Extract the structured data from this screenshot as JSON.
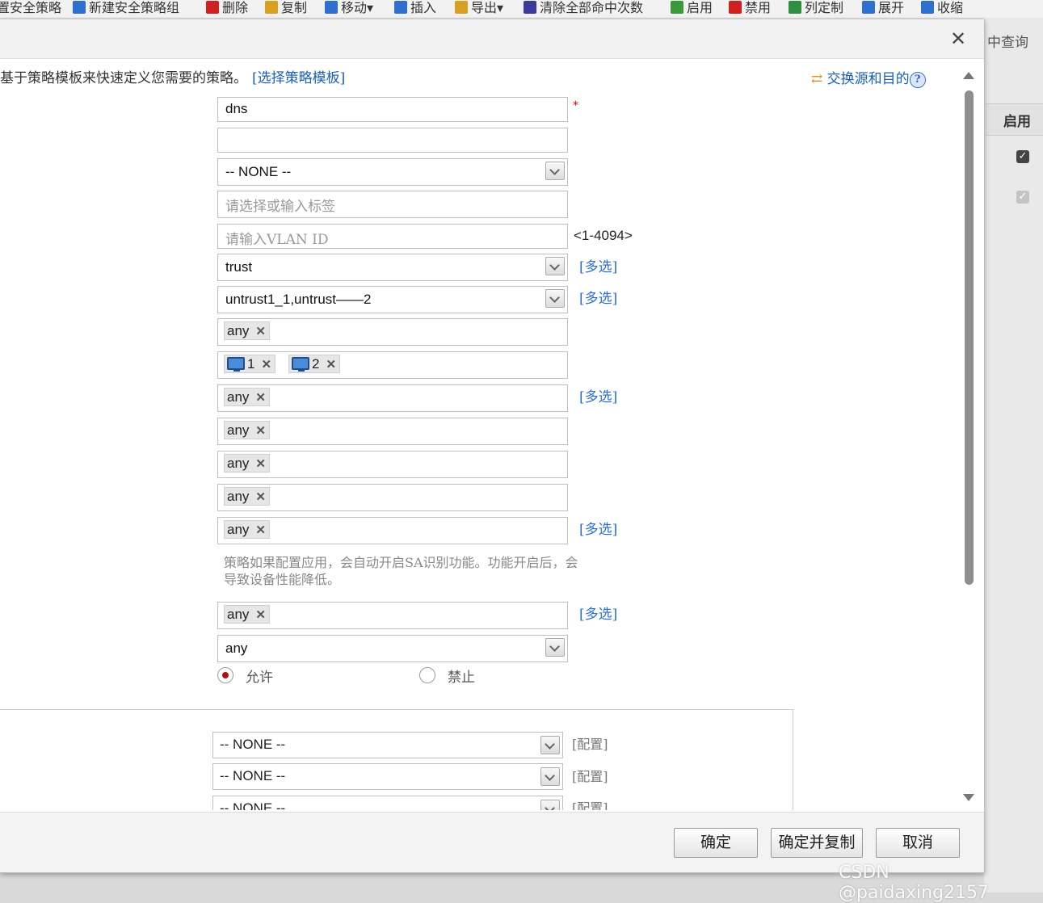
{
  "toolbar": {
    "items": [
      {
        "label": "置安全策略",
        "icon": "policy-icon",
        "color": "#3b78c8"
      },
      {
        "label": "新建安全策略组",
        "icon": "plus-icon",
        "color": "#2f6fd0"
      },
      {
        "label": "删除",
        "icon": "delete-x-icon",
        "color": "#d02020"
      },
      {
        "label": "复制",
        "icon": "copy-icon",
        "color": "#d8a020"
      },
      {
        "label": "移动▾",
        "icon": "move-icon",
        "color": "#2f6fd0"
      },
      {
        "label": "插入",
        "icon": "insert-icon",
        "color": "#2f6fd0"
      },
      {
        "label": "导出▾",
        "icon": "export-icon",
        "color": "#d8a020"
      },
      {
        "label": "清除全部命中次数",
        "icon": "clear-hits-icon",
        "color": "#3a3a9a"
      },
      {
        "label": "启用",
        "icon": "enable-icon",
        "color": "#3a9a3a"
      },
      {
        "label": "禁用",
        "icon": "disable-icon",
        "color": "#d02020"
      },
      {
        "label": "列定制",
        "icon": "column-custom-icon",
        "color": "#2f8f3f"
      },
      {
        "label": "展开",
        "icon": "expand-icon",
        "color": "#2f6fd0"
      },
      {
        "label": "收缩",
        "icon": "collapse-icon",
        "color": "#2f6fd0"
      }
    ]
  },
  "background": {
    "query_label": "中查询",
    "column_header": "启用"
  },
  "dialog": {
    "intro_text": "基于策略模板来快速定义您需要的策略。",
    "template_link": "[选择策略模板]",
    "swap_link": "交换源和目的",
    "help_glyph": "?"
  },
  "form": {
    "name_value": "dns",
    "required_mark": "*",
    "description_value": "",
    "group_select": "-- NONE --",
    "tag_placeholder": "请选择或输入标签",
    "vlan_placeholder": "请输入VLAN ID",
    "vlan_hint": "<1-4094>",
    "source_zone": "trust",
    "dest_zone": "untrust1_1,untrust——2",
    "multi_select": "[多选]",
    "source_address_tags": [
      "any"
    ],
    "dest_address_tags": [
      "1",
      "2"
    ],
    "user_tags": [
      "any"
    ],
    "service_tags": [
      "any"
    ],
    "application_tags": [
      "any"
    ],
    "url_category_tags": [
      "any"
    ],
    "time_tags": [
      "any"
    ],
    "sa_note": "策略如果配置应用，会自动开启SA识别功能。功能开启后，会导致设备性能降低。",
    "terminal_tags": [
      "any"
    ],
    "schedule_select": "any",
    "action_allow": "允许",
    "action_deny": "禁止",
    "action_selected": "allow"
  },
  "profiles": {
    "rows": [
      {
        "value": "-- NONE --",
        "config": "[配置]"
      },
      {
        "value": "-- NONE --",
        "config": "[配置]"
      },
      {
        "value": "-- NONE --",
        "config": "[配置]"
      }
    ]
  },
  "footer": {
    "ok": "确定",
    "ok_copy": "确定并复制",
    "cancel": "取消"
  },
  "watermark": "CSDN @paidaxing2157"
}
